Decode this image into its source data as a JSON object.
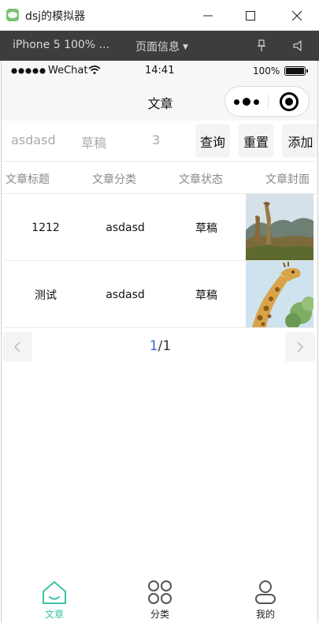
{
  "window": {
    "title": "dsj的模拟器"
  },
  "simulator": {
    "device_label": "iPhone 5 100% ...",
    "page_info_label": "页面信息"
  },
  "status_bar": {
    "carrier": "WeChat",
    "time": "14:41",
    "battery": "100%"
  },
  "nav": {
    "title": "文章"
  },
  "filters": {
    "category_value": "asdasd",
    "status_value": "草稿",
    "count_value": "3",
    "query_label": "查询",
    "reset_label": "重置",
    "add_label": "添加"
  },
  "table": {
    "columns": [
      "文章标题",
      "文章分类",
      "文章状态",
      "文章封面"
    ],
    "rows": [
      {
        "title": "1212",
        "category": "asdasd",
        "status": "草稿",
        "cover_icon": "landscape-giraffe-image"
      },
      {
        "title": "测试",
        "category": "asdasd",
        "status": "草稿",
        "cover_icon": "giraffe-closeup-image"
      }
    ]
  },
  "pagination": {
    "current": "1",
    "separator": "/",
    "total": "1"
  },
  "tabbar": {
    "items": [
      {
        "label": "文章",
        "icon": "home-icon",
        "active": true
      },
      {
        "label": "分类",
        "icon": "grid-icon",
        "active": false
      },
      {
        "label": "我的",
        "icon": "user-icon",
        "active": false
      }
    ]
  },
  "colors": {
    "accent": "#3cc0a6",
    "page_current": "#3c63d8",
    "toolbar_bg": "#3d3d3d"
  }
}
